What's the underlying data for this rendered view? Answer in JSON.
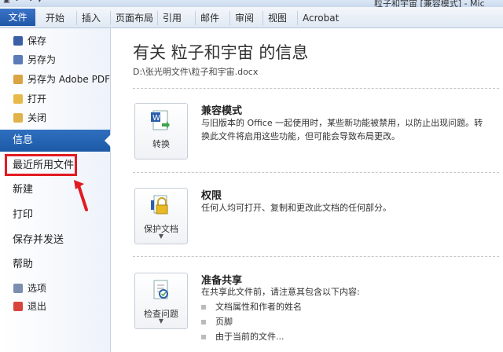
{
  "window": {
    "title": "粒子和宇宙 [兼容模式] - Mic"
  },
  "ribbon": {
    "tabs": [
      "文件",
      "开始",
      "插入",
      "页面布局",
      "引用",
      "邮件",
      "审阅",
      "视图",
      "Acrobat"
    ]
  },
  "backstage_nav": {
    "save": "保存",
    "save_as": "另存为",
    "save_as_pdf": "另存为 Adobe PDF",
    "open": "打开",
    "close": "关闭",
    "info": "信息",
    "recent": "最近所用文件",
    "new": "新建",
    "print": "打印",
    "save_send": "保存并发送",
    "help": "帮助",
    "options": "选项",
    "exit": "退出"
  },
  "main": {
    "title": "有关 粒子和宇宙 的信息",
    "path": "D:\\张光明文件\\粒子和宇宙.docx",
    "compat": {
      "button_label": "转换",
      "heading": "兼容模式",
      "desc_line1": "与旧版本的 Office 一起使用时，某些新功能被禁用，以防止出现问题。转",
      "desc_line2": "换此文件将启用这些功能，但可能会导致布局更改。"
    },
    "permissions": {
      "button_label": "保护文档",
      "heading": "权限",
      "desc": "任何人均可打开、复制和更改此文档的任何部分。"
    },
    "sharing": {
      "button_label": "检查问题",
      "heading": "准备共享",
      "desc": "在共享此文件前，请注意其包含以下内容:",
      "bullets": [
        "文档属性和作者的姓名",
        "页脚",
        "由于当前的文件..."
      ]
    }
  },
  "colors": {
    "accent": "#2f6fbf",
    "highlight": "#e21b22"
  }
}
